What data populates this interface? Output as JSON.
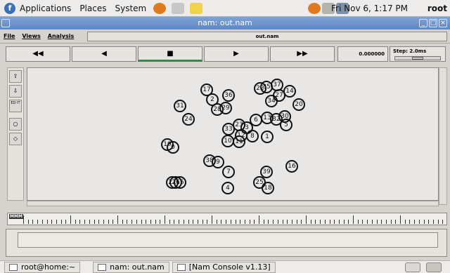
{
  "top_panel": {
    "menus": [
      "Applications",
      "Places",
      "System"
    ],
    "clock": "Fri Nov  6,  1:17 PM",
    "user": "root"
  },
  "window": {
    "title": "nam: out.nam",
    "menu": [
      "File",
      "Views",
      "Analysis"
    ],
    "file_label": "out.nam"
  },
  "controls": {
    "rewind": "◀◀",
    "back": "◀",
    "stop": "■",
    "play": "▶",
    "ffwd": "▶▶",
    "time": "0.000000",
    "step_label": "Step: 2.0ms"
  },
  "canvas": {
    "nodes": [
      "17",
      "36",
      "2",
      "28",
      "29",
      "31",
      "24",
      "37",
      "22",
      "35",
      "14",
      "27",
      "34",
      "20",
      "33",
      "23",
      "6",
      "13",
      "32",
      "30",
      "5",
      "8",
      "1",
      "12",
      "11",
      "10",
      "19",
      "0",
      "38",
      "9",
      "7",
      "39",
      "16",
      "26",
      "25",
      "4",
      "18",
      "3",
      "15",
      "21"
    ]
  },
  "timeline": {
    "label": "MMM"
  },
  "taskbar": {
    "items": [
      "root@home:~",
      "nam: out.nam",
      "[Nam Console v1.13]"
    ]
  }
}
